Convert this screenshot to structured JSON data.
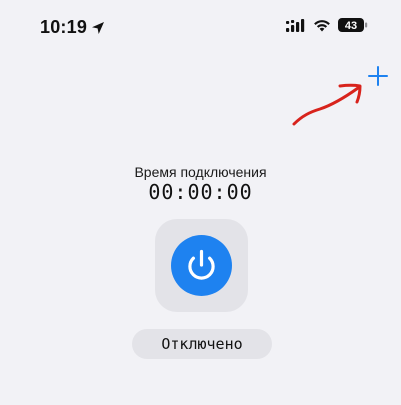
{
  "status_bar": {
    "time": "10:19",
    "battery_level": "43",
    "location_icon": "location-arrow-icon",
    "signal_icon": "cellular-signal-icon",
    "wifi_icon": "wifi-icon",
    "battery_icon": "battery-icon"
  },
  "toolbar": {
    "add_icon": "plus-icon",
    "accent_color": "#1e82f0"
  },
  "annotation": {
    "arrow_color": "#d8231c"
  },
  "connection": {
    "label": "Время подключения",
    "timer": "00:00:00",
    "power_icon": "power-icon",
    "status": "Отключено"
  }
}
